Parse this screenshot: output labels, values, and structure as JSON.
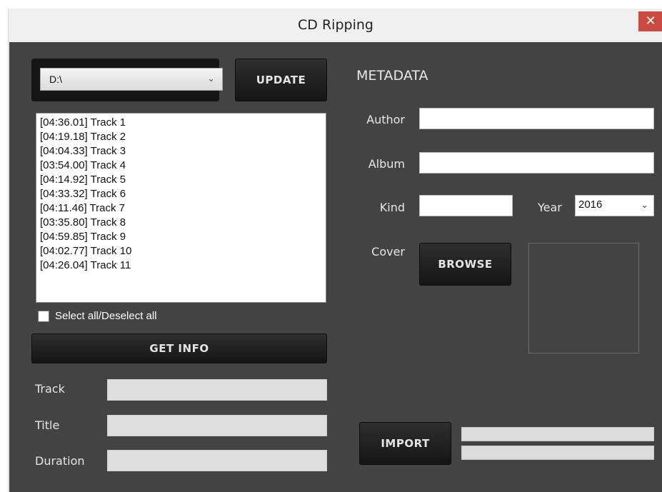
{
  "window": {
    "title": "CD Ripping",
    "close_glyph": "✕"
  },
  "drive": {
    "selected": "D:\\",
    "chevron_icon": "chevron-down-icon",
    "chevron_glyph": "⌄",
    "update_label": "UPDATE"
  },
  "tracks": [
    "[04:36.01] Track 1",
    "[04:19.18] Track 2",
    "[04:04.33] Track 3",
    "[03:54.00] Track 4",
    "[04:14.92] Track 5",
    "[04:33.32] Track 6",
    "[04:11.46] Track 7",
    "[03:35.80] Track 8",
    "[04:59.85] Track 9",
    "[04:02.77] Track 10",
    "[04:26.04] Track 11"
  ],
  "select_all": {
    "label": "Select all/Deselect all",
    "checked": false
  },
  "get_info_label": "GET INFO",
  "track_info": {
    "track_label": "Track",
    "title_label": "Title",
    "duration_label": "Duration"
  },
  "metadata": {
    "heading": "METADATA",
    "author_label": "Author",
    "album_label": "Album",
    "kind_label": "Kind",
    "year_label": "Year",
    "year_value": "2016",
    "year_chevron_glyph": "⌄",
    "cover_label": "Cover",
    "browse_label": "BROWSE"
  },
  "import": {
    "label": "IMPORT",
    "progress_1": 0,
    "progress_2": 0
  },
  "colors": {
    "client_bg": "#434343",
    "button_bg": "#1e1e1e",
    "close_bg": "#c94b42"
  }
}
